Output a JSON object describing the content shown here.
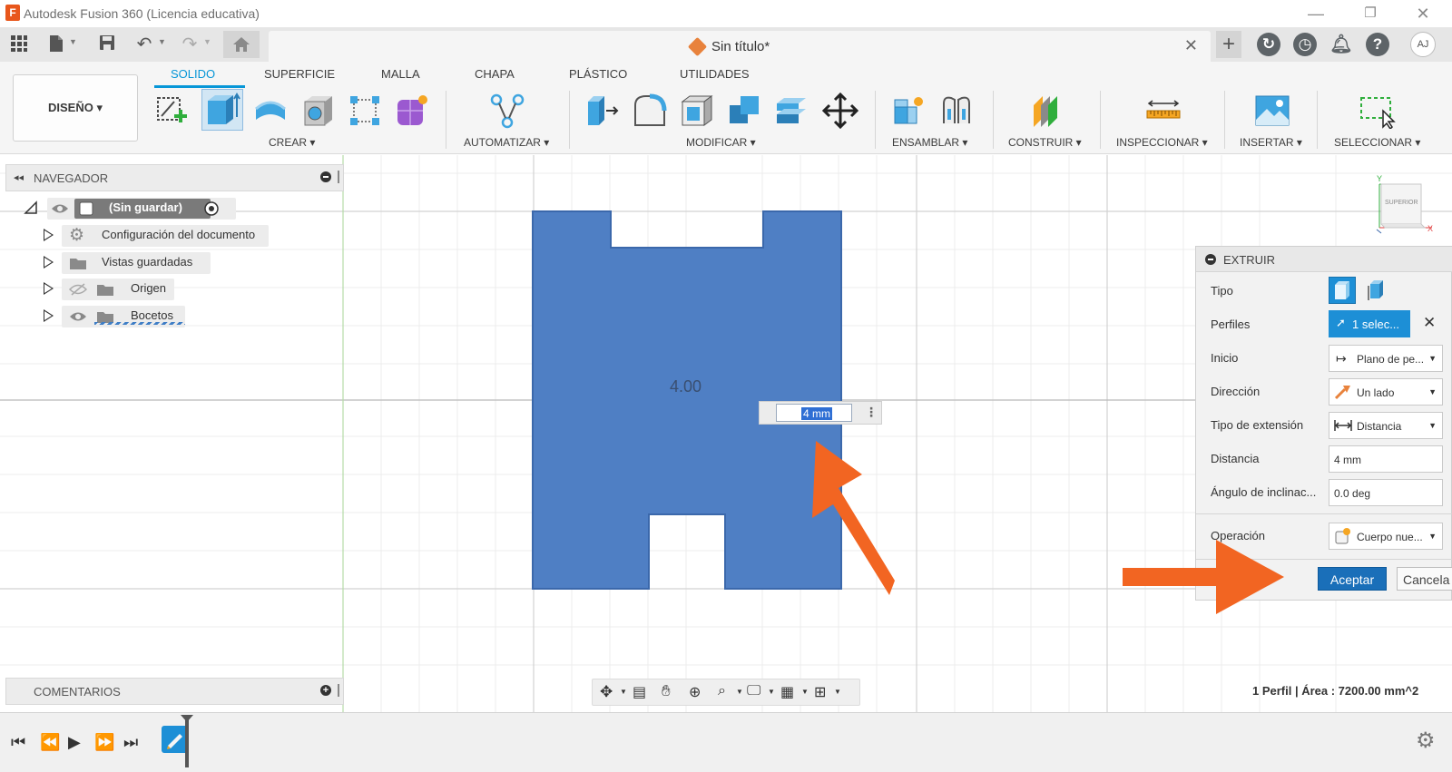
{
  "window": {
    "title": "Autodesk Fusion 360 (Licencia educativa)",
    "app_icon": "F"
  },
  "tabbar": {
    "doc_title": "Sin título*",
    "avatar": "AJ"
  },
  "ribbon": {
    "workspace": "DISEÑO ▾",
    "tabs": [
      "SOLIDO",
      "SUPERFICIE",
      "MALLA",
      "CHAPA",
      "PLÁSTICO",
      "UTILIDADES"
    ],
    "active_tab": "SOLIDO",
    "groups": {
      "crear": "CREAR ▾",
      "automatizar": "AUTOMATIZAR ▾",
      "modificar": "MODIFICAR ▾",
      "ensamblar": "ENSAMBLAR ▾",
      "construir": "CONSTRUIR ▾",
      "inspeccionar": "INSPECCIONAR ▾",
      "insertar": "INSERTAR ▾",
      "seleccionar": "SELECCIONAR ▾"
    }
  },
  "navigator": {
    "title": "NAVEGADOR",
    "root": "(Sin guardar)",
    "items": [
      "Configuración del documento",
      "Vistas guardadas",
      "Origen",
      "Bocetos"
    ]
  },
  "comments": {
    "title": "COMENTARIOS"
  },
  "viewcube": {
    "label": "SUPERIOR"
  },
  "canvas": {
    "dimension_label": "4.00",
    "input_value": "4 mm"
  },
  "extrude": {
    "title": "EXTRUIR",
    "rows": {
      "tipo": {
        "label": "Tipo"
      },
      "perfiles": {
        "label": "Perfiles",
        "value": "1 selec..."
      },
      "inicio": {
        "label": "Inicio",
        "value": "Plano de pe..."
      },
      "direccion": {
        "label": "Dirección",
        "value": "Un lado"
      },
      "tipo_extension": {
        "label": "Tipo de extensión",
        "value": "Distancia"
      },
      "distancia": {
        "label": "Distancia",
        "value": "4 mm"
      },
      "angulo": {
        "label": "Ángulo de inclinac...",
        "value": "0.0 deg"
      },
      "operacion": {
        "label": "Operación",
        "value": "Cuerpo nue..."
      }
    },
    "ok": "Aceptar",
    "cancel": "Cancela"
  },
  "status": {
    "text": "1 Perfil | Área : 7200.00 mm^2"
  },
  "colors": {
    "accent": "#0696d7",
    "profile_fill": "#4f7fc4",
    "arrow": "#f26522",
    "ok_button": "#1a6fb9"
  }
}
